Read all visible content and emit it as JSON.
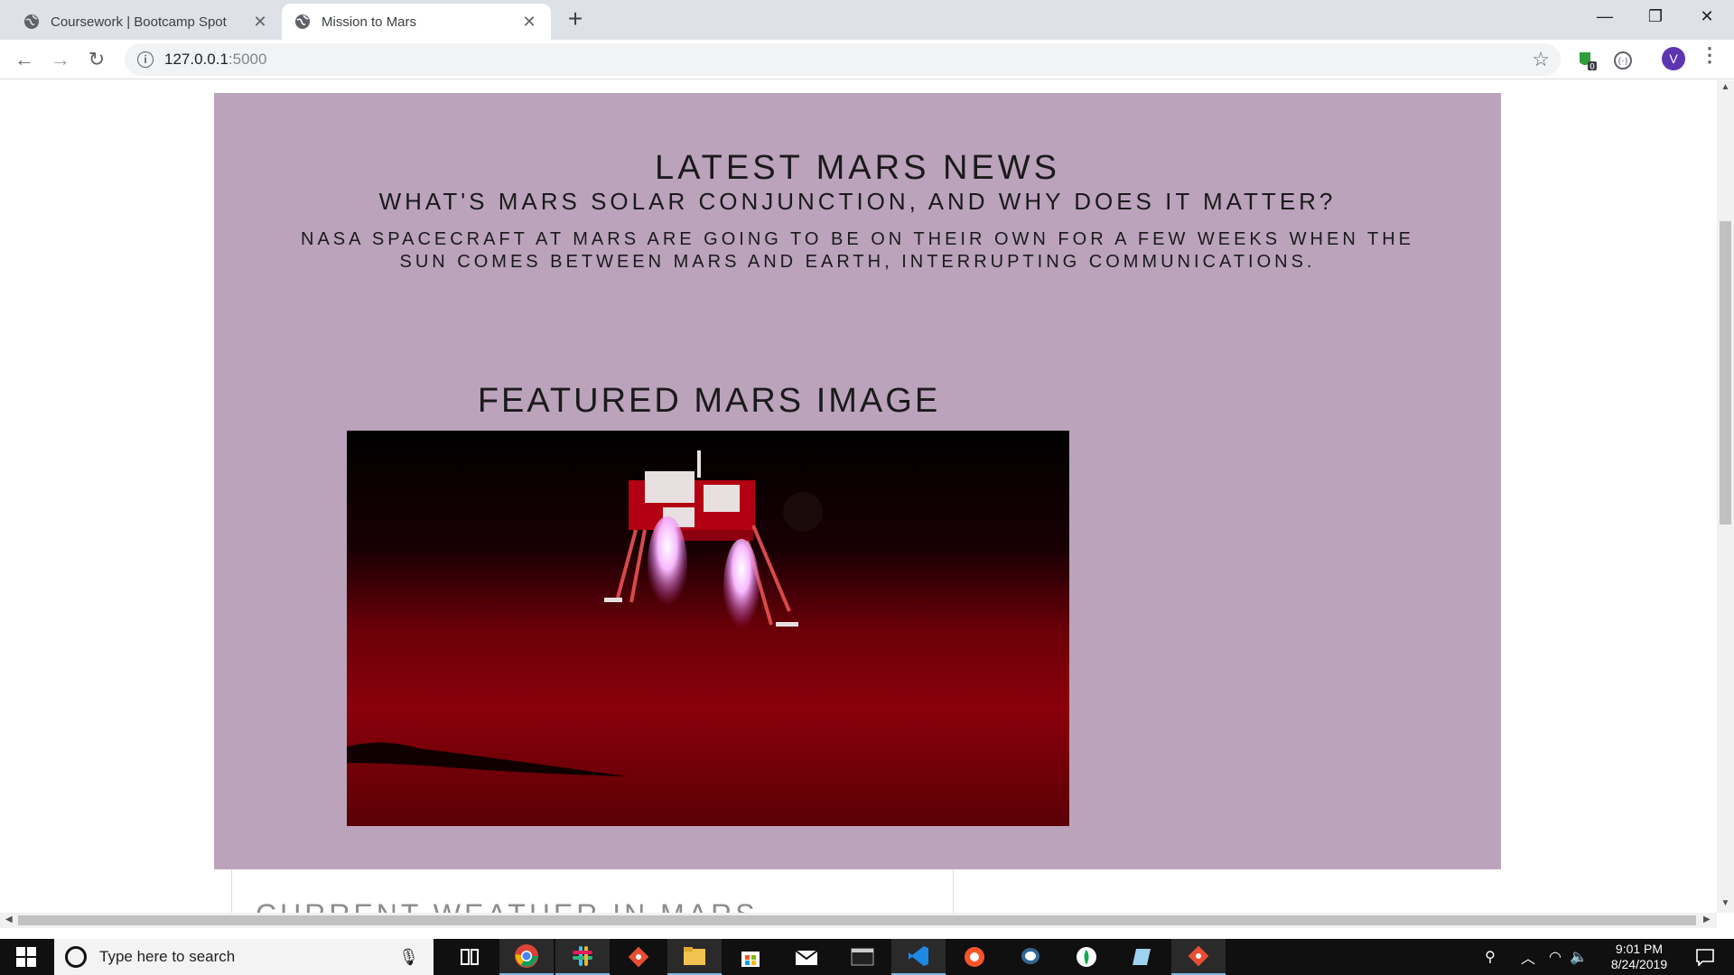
{
  "browser": {
    "tabs": [
      {
        "title": "Coursework | Bootcamp Spot",
        "active": false
      },
      {
        "title": "Mission to Mars",
        "active": true
      }
    ],
    "new_tab_label": "+",
    "address": {
      "host": "127.0.0.1",
      "port": ":5000"
    },
    "profile_initial": "V",
    "extension_badge": "0"
  },
  "page": {
    "news_heading": "LATEST MARS NEWS",
    "news_title": "WHAT'S MARS SOLAR CONJUNCTION, AND WHY DOES IT MATTER?",
    "news_paragraph": "NASA SPACECRAFT AT MARS ARE GOING TO BE ON THEIR OWN FOR A FEW WEEKS WHEN THE SUN COMES BETWEEN MARS AND EARTH, INTERRUPTING COMMUNICATIONS.",
    "featured_heading": "FEATURED MARS IMAGE",
    "weather_heading": "CURRENT WEATHER IN MARS",
    "jumbotron_color": "#bba3bc"
  },
  "taskbar": {
    "search_placeholder": "Type here to search",
    "time": "9:01 PM",
    "date": "8/24/2019",
    "pinned_icons": [
      "task-view-icon",
      "chrome-icon",
      "slack-icon",
      "git-icon",
      "file-explorer-icon",
      "store-icon",
      "mail-icon",
      "terminal-icon",
      "vscode-icon",
      "brave-icon",
      "postgres-icon",
      "mongodb-icon",
      "notepad-icon",
      "git-kraken-icon"
    ]
  }
}
